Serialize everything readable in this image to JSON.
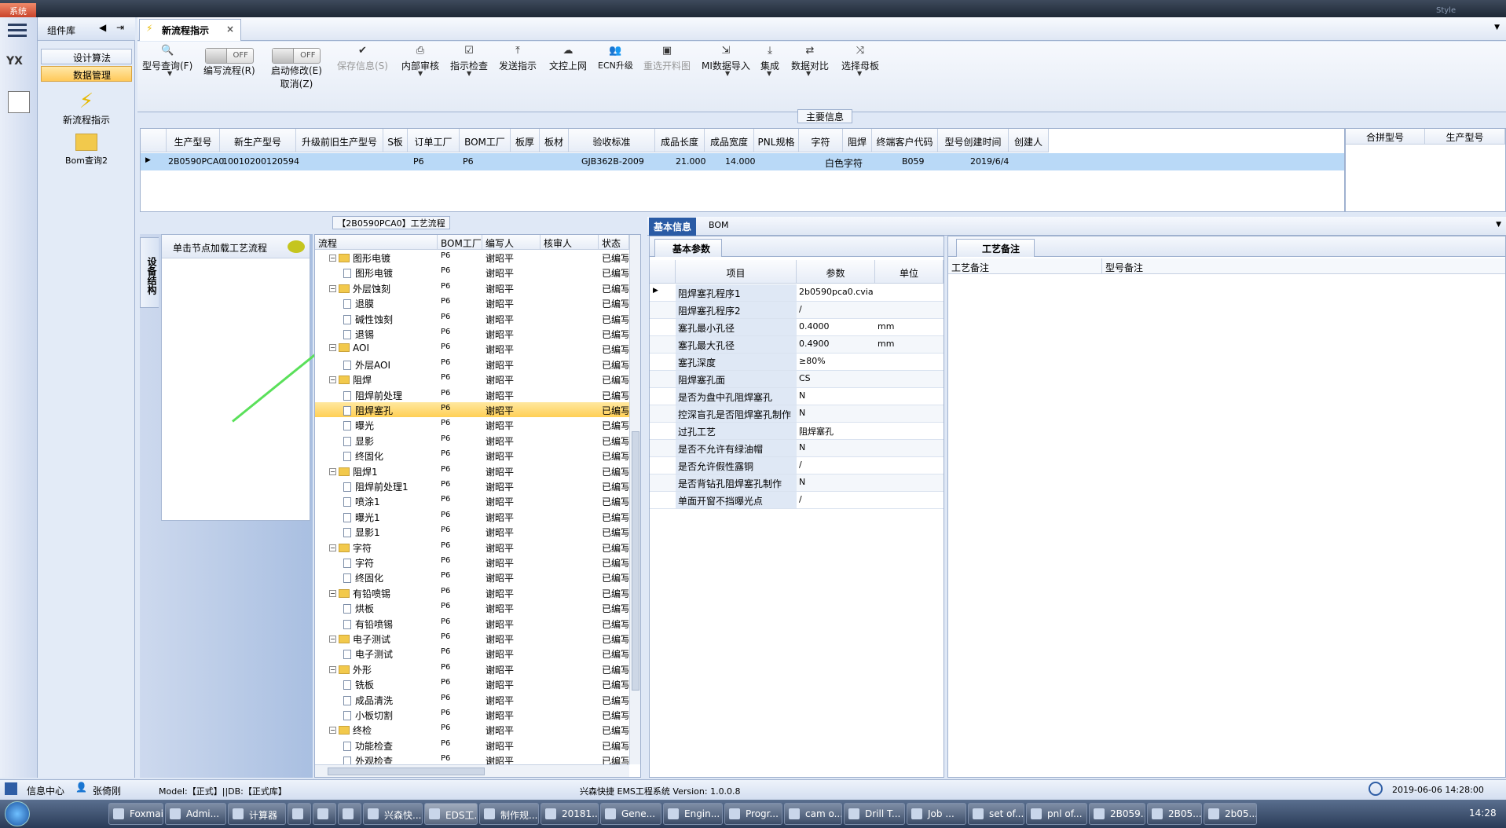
{
  "system_label": "系统",
  "window_right_label": "Style",
  "sidebar": {
    "title": "组件库",
    "items": [
      {
        "label": "设计算法",
        "selected": false
      },
      {
        "label": "数据管理",
        "selected": true
      }
    ],
    "big_items": [
      {
        "label": "新流程指示",
        "icon": "lightning-icon"
      },
      {
        "label": "Bom查询2",
        "icon": "folder-icon"
      }
    ]
  },
  "active_tab": "新流程指示",
  "toolbar": {
    "buttons": [
      {
        "label": "型号查询(F)",
        "icon": "search-icon"
      },
      {
        "label": "编写流程(R)",
        "toggle": "OFF"
      },
      {
        "label": "启动修改(E)",
        "label2": "取消(Z)",
        "toggle": "OFF"
      },
      {
        "label": "保存信息(S)",
        "icon": "check-icon",
        "disabled": true
      },
      {
        "label": "内部审核",
        "icon": "print-icon"
      },
      {
        "label": "指示检查",
        "icon": "checklist-icon"
      },
      {
        "label": "发送指示",
        "icon": "upload-icon"
      },
      {
        "label": "文控上网",
        "icon": "cloud-upload-icon"
      },
      {
        "label": "ECN升级",
        "icon": "people-icon"
      },
      {
        "label": "重选开料图",
        "icon": "image-icon",
        "disabled": true
      },
      {
        "label": "MI数据导入",
        "icon": "import-icon"
      },
      {
        "label": "集成",
        "icon": "download-icon"
      },
      {
        "label": "数据对比",
        "icon": "compare-icon"
      },
      {
        "label": "选择母板",
        "icon": "shuffle-icon"
      }
    ]
  },
  "main_info": {
    "title": "主要信息",
    "columns": [
      "生产型号",
      "新生产型号",
      "升级前旧生产型号",
      "S板",
      "订单工厂",
      "BOM工厂",
      "板厚",
      "板材",
      "验收标准",
      "成品长度",
      "成品宽度",
      "PNL规格",
      "字符",
      "阻焊",
      "终端客户代码",
      "型号创建时间",
      "创建人"
    ],
    "rows": [
      [
        "2B0590PCA0",
        "10010200120594",
        "",
        "",
        "P6",
        "P6",
        "",
        "",
        "GJB362B-2009",
        "21.000",
        "14.000",
        "",
        "白色字符",
        "",
        "B059",
        "2019/6/4",
        ""
      ]
    ],
    "side_columns": [
      "合拼型号",
      "生产型号"
    ]
  },
  "flow_section_title": "【2B0590PCA0】工艺流程",
  "left_panel": {
    "vertical_tab": "设备结构",
    "load_hint": "单击节点加载工艺流程"
  },
  "flow_tree": {
    "columns": [
      "流程",
      "BOM工厂",
      "编写人",
      "核审人",
      "状态"
    ],
    "rows": [
      {
        "name": "图形电镀",
        "level": 0,
        "factory": "P6",
        "writer": "谢昭平",
        "reviewer": "",
        "status": "已编写"
      },
      {
        "name": "图形电镀",
        "level": 1,
        "factory": "P6",
        "writer": "谢昭平",
        "reviewer": "",
        "status": "已编写"
      },
      {
        "name": "外层蚀刻",
        "level": 0,
        "factory": "P6",
        "writer": "谢昭平",
        "reviewer": "",
        "status": "已编写"
      },
      {
        "name": "退膜",
        "level": 1,
        "factory": "P6",
        "writer": "谢昭平",
        "reviewer": "",
        "status": "已编写"
      },
      {
        "name": "碱性蚀刻",
        "level": 1,
        "factory": "P6",
        "writer": "谢昭平",
        "reviewer": "",
        "status": "已编写"
      },
      {
        "name": "退锡",
        "level": 1,
        "factory": "P6",
        "writer": "谢昭平",
        "reviewer": "",
        "status": "已编写"
      },
      {
        "name": "AOI",
        "level": 0,
        "factory": "P6",
        "writer": "谢昭平",
        "reviewer": "",
        "status": "已编写"
      },
      {
        "name": "外层AOI",
        "level": 1,
        "factory": "P6",
        "writer": "谢昭平",
        "reviewer": "",
        "status": "已编写"
      },
      {
        "name": "阻焊",
        "level": 0,
        "factory": "P6",
        "writer": "谢昭平",
        "reviewer": "",
        "status": "已编写"
      },
      {
        "name": "阻焊前处理",
        "level": 1,
        "factory": "P6",
        "writer": "谢昭平",
        "reviewer": "",
        "status": "已编写"
      },
      {
        "name": "阻焊塞孔",
        "level": 1,
        "factory": "P6",
        "writer": "谢昭平",
        "reviewer": "",
        "status": "已编写",
        "selected": true
      },
      {
        "name": "曝光",
        "level": 1,
        "factory": "P6",
        "writer": "谢昭平",
        "reviewer": "",
        "status": "已编写"
      },
      {
        "name": "显影",
        "level": 1,
        "factory": "P6",
        "writer": "谢昭平",
        "reviewer": "",
        "status": "已编写"
      },
      {
        "name": "终固化",
        "level": 1,
        "factory": "P6",
        "writer": "谢昭平",
        "reviewer": "",
        "status": "已编写"
      },
      {
        "name": "阻焊1",
        "level": 0,
        "factory": "P6",
        "writer": "谢昭平",
        "reviewer": "",
        "status": "已编写"
      },
      {
        "name": "阻焊前处理1",
        "level": 1,
        "factory": "P6",
        "writer": "谢昭平",
        "reviewer": "",
        "status": "已编写"
      },
      {
        "name": "喷涂1",
        "level": 1,
        "factory": "P6",
        "writer": "谢昭平",
        "reviewer": "",
        "status": "已编写"
      },
      {
        "name": "曝光1",
        "level": 1,
        "factory": "P6",
        "writer": "谢昭平",
        "reviewer": "",
        "status": "已编写"
      },
      {
        "name": "显影1",
        "level": 1,
        "factory": "P6",
        "writer": "谢昭平",
        "reviewer": "",
        "status": "已编写"
      },
      {
        "name": "字符",
        "level": 0,
        "factory": "P6",
        "writer": "谢昭平",
        "reviewer": "",
        "status": "已编写"
      },
      {
        "name": "字符",
        "level": 1,
        "factory": "P6",
        "writer": "谢昭平",
        "reviewer": "",
        "status": "已编写"
      },
      {
        "name": "终固化",
        "level": 1,
        "factory": "P6",
        "writer": "谢昭平",
        "reviewer": "",
        "status": "已编写"
      },
      {
        "name": "有铅喷锡",
        "level": 0,
        "factory": "P6",
        "writer": "谢昭平",
        "reviewer": "",
        "status": "已编写"
      },
      {
        "name": "烘板",
        "level": 1,
        "factory": "P6",
        "writer": "谢昭平",
        "reviewer": "",
        "status": "已编写"
      },
      {
        "name": "有铅喷锡",
        "level": 1,
        "factory": "P6",
        "writer": "谢昭平",
        "reviewer": "",
        "status": "已编写"
      },
      {
        "name": "电子测试",
        "level": 0,
        "factory": "P6",
        "writer": "谢昭平",
        "reviewer": "",
        "status": "已编写"
      },
      {
        "name": "电子测试",
        "level": 1,
        "factory": "P6",
        "writer": "谢昭平",
        "reviewer": "",
        "status": "已编写"
      },
      {
        "name": "外形",
        "level": 0,
        "factory": "P6",
        "writer": "谢昭平",
        "reviewer": "",
        "status": "已编写"
      },
      {
        "name": "铣板",
        "level": 1,
        "factory": "P6",
        "writer": "谢昭平",
        "reviewer": "",
        "status": "已编写"
      },
      {
        "name": "成品清洗",
        "level": 1,
        "factory": "P6",
        "writer": "谢昭平",
        "reviewer": "",
        "status": "已编写"
      },
      {
        "name": "小板切割",
        "level": 1,
        "factory": "P6",
        "writer": "谢昭平",
        "reviewer": "",
        "status": "已编写"
      },
      {
        "name": "终检",
        "level": 0,
        "factory": "P6",
        "writer": "谢昭平",
        "reviewer": "",
        "status": "已编写"
      },
      {
        "name": "功能检查",
        "level": 1,
        "factory": "P6",
        "writer": "谢昭平",
        "reviewer": "",
        "status": "已编写"
      },
      {
        "name": "外观检查",
        "level": 1,
        "factory": "P6",
        "writer": "谢昭平",
        "reviewer": "",
        "status": "已编写"
      }
    ]
  },
  "right_tabs": [
    {
      "label": "基本信息",
      "selected": true
    },
    {
      "label": "BOM",
      "selected": false
    }
  ],
  "params": {
    "tab": "基本参数",
    "columns": [
      "项目",
      "参数",
      "单位"
    ],
    "rows": [
      [
        "阻焊塞孔程序1",
        "2b0590pca0.cvia",
        ""
      ],
      [
        "阻焊塞孔程序2",
        "/",
        ""
      ],
      [
        "塞孔最小孔径",
        "0.4000",
        "mm"
      ],
      [
        "塞孔最大孔径",
        "0.4900",
        "mm"
      ],
      [
        "塞孔深度",
        "≥80%",
        ""
      ],
      [
        "阻焊塞孔面",
        "CS",
        ""
      ],
      [
        "是否为盘中孔阻焊塞孔",
        "N",
        ""
      ],
      [
        "控深盲孔是否阻焊塞孔制作",
        "N",
        ""
      ],
      [
        "过孔工艺",
        "阻焊塞孔",
        ""
      ],
      [
        "是否不允许有绿油帽",
        "N",
        ""
      ],
      [
        "是否允许假性露铜",
        "/",
        ""
      ],
      [
        "是否背钻孔阻焊塞孔制作",
        "N",
        ""
      ],
      [
        "单面开窗不挡曝光点",
        "/",
        ""
      ]
    ]
  },
  "notes": {
    "tab": "工艺备注",
    "col1": "工艺备注",
    "col2": "型号备注"
  },
  "statusbar": {
    "info_center": "信息中心",
    "user": "张倚刚",
    "model": "Model:【正式】||DB:【正式库】",
    "app": "兴森快捷 EMS工程系统 Version: 1.0.0.8",
    "datetime": "2019-06-06 14:28:00"
  },
  "taskbar": {
    "items": [
      "Foxmail",
      "Admi...",
      "计算器",
      "",
      "",
      "",
      "兴森快...",
      "EDS工...",
      "制作规...",
      "20181...",
      "Gene...",
      "Engin...",
      "Progr...",
      "cam o...",
      "Drill T...",
      "Job ...",
      "set of...",
      "pnl of...",
      "2B059...",
      "2B05...",
      "2b05..."
    ],
    "clock": "14:28"
  }
}
